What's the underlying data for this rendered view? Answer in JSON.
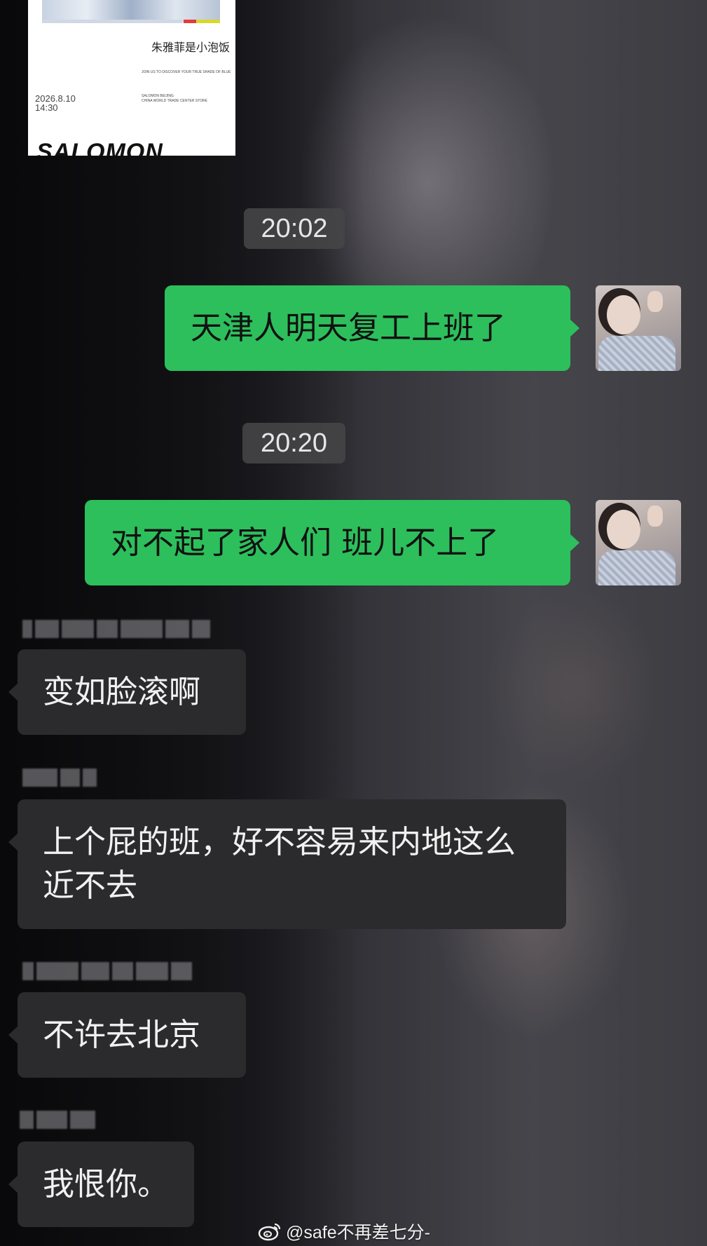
{
  "shared_card": {
    "title": "朱雅菲是小泡饭",
    "date": "2026.8.10",
    "time": "14:30",
    "brand": "SALOMON",
    "fine_print_1": "JOIN US TO DISCOVER YOUR TRUE SHADE OF BLUE",
    "fine_print_2": "SALOMON BEIJING",
    "fine_print_3": "CHINA WORLD TRADE CENTER STORE"
  },
  "messages": [
    {
      "kind": "time",
      "text": "20:02"
    },
    {
      "kind": "outgoing",
      "text": "天津人明天复工上班了"
    },
    {
      "kind": "time",
      "text": "20:20"
    },
    {
      "kind": "outgoing",
      "text": "对不起了家人们 班儿不上了"
    },
    {
      "kind": "incoming",
      "text": "变如脸滚啊"
    },
    {
      "kind": "incoming",
      "text": "上个屁的班，好不容易来内地这么近不去"
    },
    {
      "kind": "incoming",
      "text": "不许去北京"
    },
    {
      "kind": "incoming",
      "text": "我恨你。"
    }
  ],
  "watermark": {
    "text": "@safe不再差七分-",
    "icon": "weibo-icon"
  },
  "colors": {
    "outgoing_bubble": "#2dbf5c",
    "incoming_bubble": "#2b2b2d",
    "time_pill": "#464648"
  }
}
